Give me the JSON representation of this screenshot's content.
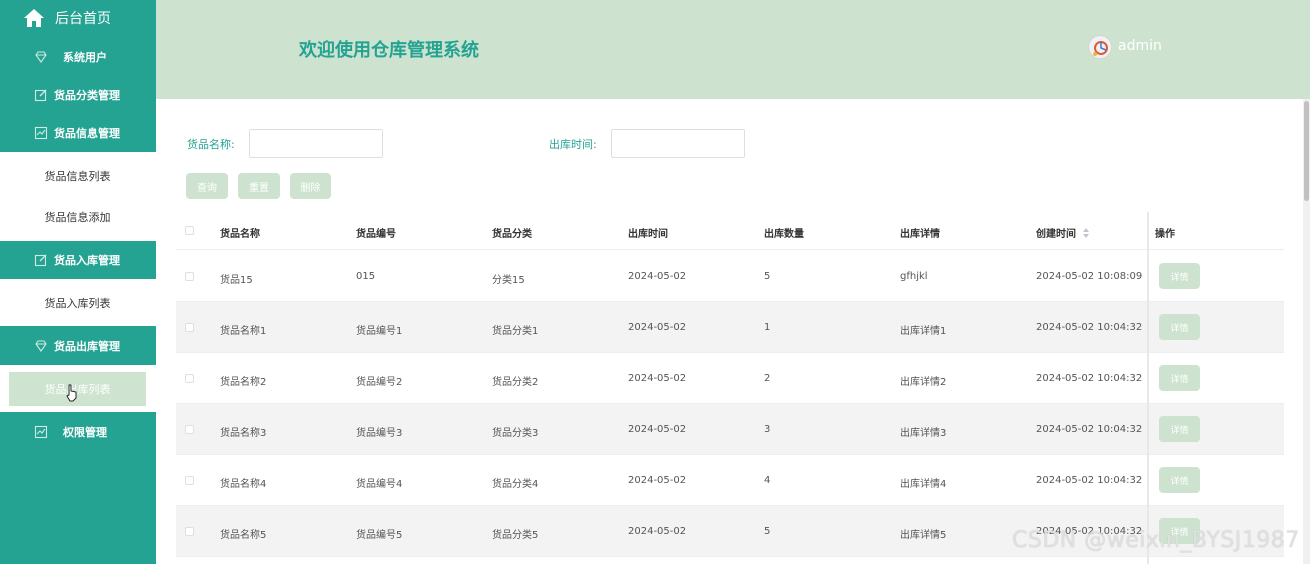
{
  "sidebar": {
    "home_label": "后台首页",
    "menus": [
      {
        "label": "系统用户",
        "icon": "diamond-icon"
      },
      {
        "label": "货品分类管理",
        "icon": "edit-icon"
      },
      {
        "label": "货品信息管理",
        "icon": "chart-icon"
      },
      {
        "label": "货品入库管理",
        "icon": "edit-icon"
      },
      {
        "label": "货品出库管理",
        "icon": "diamond-icon"
      },
      {
        "label": "权限管理",
        "icon": "chart-icon"
      }
    ],
    "subitems": {
      "goods_info_list": "货品信息列表",
      "goods_info_add": "货品信息添加",
      "inbound_list": "货品入库列表",
      "outbound_list": "货品出库列表"
    }
  },
  "header": {
    "title": "欢迎使用仓库管理系统",
    "username": "admin"
  },
  "search": {
    "name_label": "货品名称:",
    "name_value": "",
    "time_label": "出库时间:",
    "time_value": ""
  },
  "buttons": {
    "query": "查询",
    "reset": "重置",
    "delete": "删除"
  },
  "table": {
    "columns": [
      "货品名称",
      "货品编号",
      "货品分类",
      "出库时间",
      "出库数量",
      "出库详情",
      "创建时间",
      "操作"
    ],
    "detail_label": "详情",
    "rows": [
      [
        "货品15",
        "015",
        "分类15",
        "2024-05-02",
        "5",
        "gfhjkl",
        "2024-05-02 10:08:09"
      ],
      [
        "货品名称1",
        "货品编号1",
        "货品分类1",
        "2024-05-02",
        "1",
        "出库详情1",
        "2024-05-02 10:04:32"
      ],
      [
        "货品名称2",
        "货品编号2",
        "货品分类2",
        "2024-05-02",
        "2",
        "出库详情2",
        "2024-05-02 10:04:32"
      ],
      [
        "货品名称3",
        "货品编号3",
        "货品分类3",
        "2024-05-02",
        "3",
        "出库详情3",
        "2024-05-02 10:04:32"
      ],
      [
        "货品名称4",
        "货品编号4",
        "货品分类4",
        "2024-05-02",
        "4",
        "出库详情4",
        "2024-05-02 10:04:32"
      ],
      [
        "货品名称5",
        "货品编号5",
        "货品分类5",
        "2024-05-02",
        "5",
        "出库详情5",
        "2024-05-02 10:04:32"
      ]
    ]
  },
  "watermark": "CSDN @weixin_BYSJ1987",
  "colors": {
    "primary": "#24a393",
    "header_bg": "#cde3cf",
    "button_bg": "#cde3cf"
  }
}
